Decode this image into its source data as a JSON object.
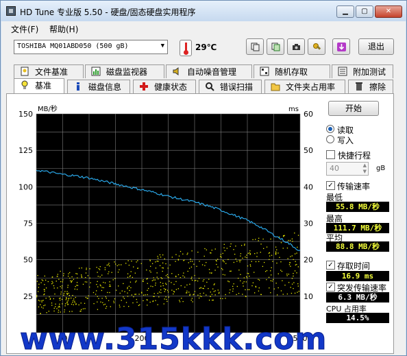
{
  "window": {
    "title": "HD Tune 专业版 5.50 - 硬盘/固态硬盘实用程序"
  },
  "menu": {
    "file": "文件(F)",
    "help": "帮助(H)"
  },
  "toolbar": {
    "drive": "TOSHIBA MQ01ABD050 (500 gB)",
    "temperature": "29℃",
    "exit_label": "退出",
    "icons": [
      "copy-icon",
      "copy-all-icon",
      "camera-icon",
      "options-icon",
      "download-icon"
    ]
  },
  "tabs_row1": [
    "文件基准",
    "磁盘监视器",
    "自动噪音管理",
    "随机存取",
    "附加测试"
  ],
  "tabs_row2": [
    "基准",
    "磁盘信息",
    "健康状态",
    "错误扫描",
    "文件夹占用率",
    "擦除"
  ],
  "active_tab": "基准",
  "side": {
    "start_label": "开始",
    "read_label": "读取",
    "write_label": "写入",
    "quick_label": "快捷行程",
    "quick_value": "40",
    "quick_unit": "gB",
    "transfer_label": "传输速率",
    "min_label": "最低",
    "min_value": "55.8 MB/秒",
    "max_label": "最高",
    "max_value": "111.7 MB/秒",
    "avg_label": "平均",
    "avg_value": "88.8 MB/秒",
    "access_label": "存取时间",
    "access_value": "16.9 ms",
    "burst_label": "突发传输速率",
    "burst_value": "6.3 MB/秒",
    "cpu_label": "CPU 占用率",
    "cpu_value": "14.5%"
  },
  "watermark": "www.315kkk.com",
  "chart_data": {
    "type": "line",
    "ylabel": "MB/秒",
    "y2label": "ms",
    "ylim": [
      0,
      150
    ],
    "y2lim": [
      0,
      60
    ],
    "yticks": [
      150,
      125,
      100,
      75,
      50,
      25
    ],
    "y2ticks": [
      60,
      50,
      40,
      30,
      20,
      10
    ],
    "xticks_visible": [
      "50",
      "200",
      "500"
    ],
    "xlim": [
      0,
      500
    ],
    "grid": true,
    "series": [
      {
        "name": "传输速率",
        "color": "#2aa7e8",
        "x": [
          0,
          25,
          50,
          75,
          100,
          125,
          150,
          175,
          200,
          225,
          250,
          275,
          300,
          325,
          350,
          375,
          400,
          425,
          450,
          475,
          500
        ],
        "y": [
          111.5,
          110,
          108.5,
          107.5,
          106,
          104,
          102,
          100,
          98,
          96,
          93.5,
          91.5,
          89.5,
          87,
          84,
          80.5,
          77,
          72.5,
          67,
          62,
          56
        ]
      },
      {
        "name": "存取时间",
        "color": "#f0f000",
        "kind": "scatter",
        "y_range_ms": [
          5,
          28
        ]
      }
    ]
  },
  "colors": {
    "chart_bg": "#000000",
    "grid": "#808080",
    "transfer": "#2aa7e8",
    "access": "#f0f000",
    "watermark": "#1238c8"
  }
}
